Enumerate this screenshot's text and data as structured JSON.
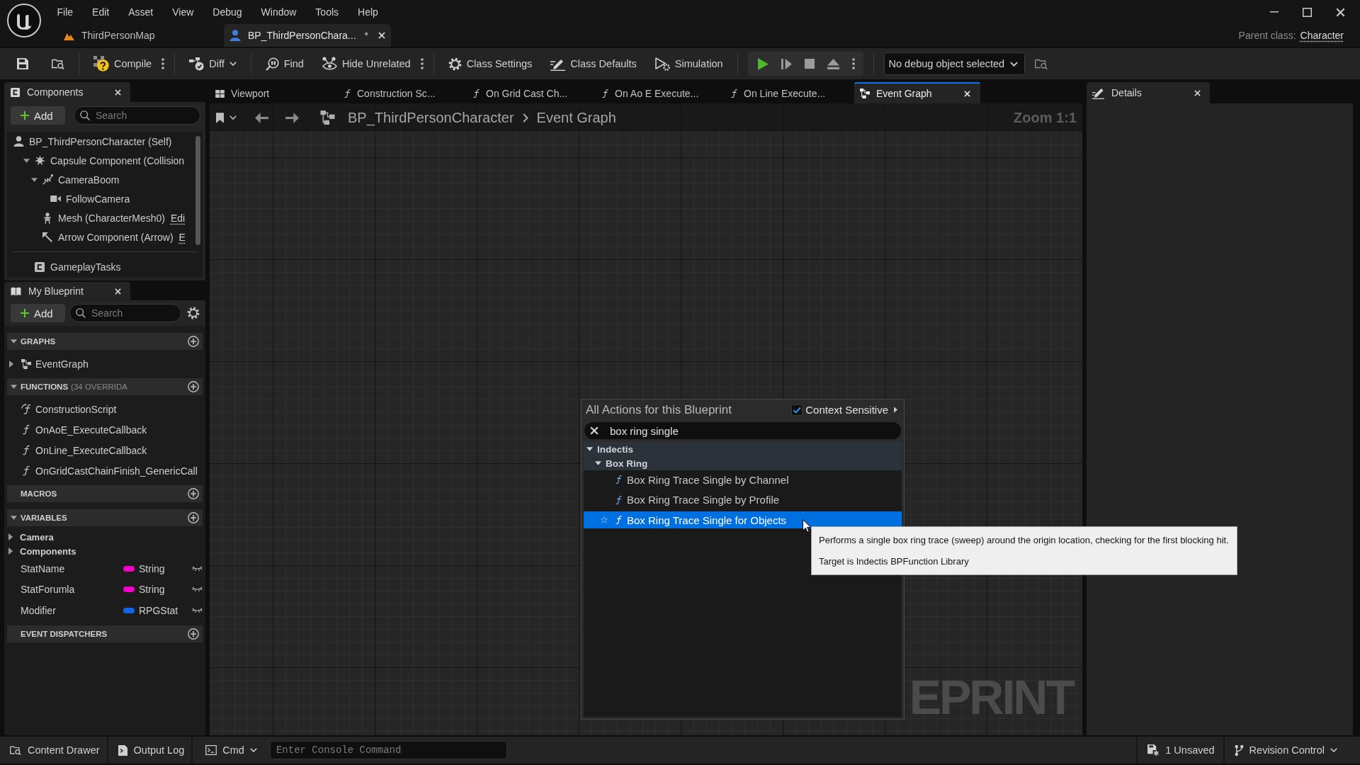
{
  "menu_bar": [
    "File",
    "Edit",
    "Asset",
    "View",
    "Debug",
    "Window",
    "Tools",
    "Help"
  ],
  "document_tabs": [
    {
      "label": "ThirdPersonMap",
      "kind": "level",
      "selected": false
    },
    {
      "label": "BP_ThirdPersonChara...",
      "kind": "blueprint",
      "selected": true,
      "unsaved_mark": "*"
    }
  ],
  "parent_class": {
    "label": "Parent class:",
    "value": "Character"
  },
  "toolbar": {
    "groups": [
      {
        "buttons": [
          {
            "kind": "save",
            "options": false,
            "dropdown": false
          },
          {
            "kind": "browse",
            "options": false,
            "dropdown": false
          }
        ]
      },
      {
        "buttons": [
          {
            "kind": "compile",
            "label": "Compile",
            "options": true,
            "dropdown": false
          }
        ]
      },
      {
        "buttons": [
          {
            "kind": "diff",
            "label": "Diff",
            "options": false,
            "dropdown": true
          }
        ]
      },
      {
        "buttons": [
          {
            "kind": "find",
            "label": "Find",
            "options": false,
            "dropdown": false
          },
          {
            "kind": "hide_unrelated",
            "label": "Hide Unrelated",
            "options": true,
            "dropdown": false
          }
        ]
      },
      {
        "buttons": [
          {
            "kind": "class_settings",
            "label": "Class Settings",
            "options": false,
            "dropdown": false
          },
          {
            "kind": "class_defaults",
            "label": "Class Defaults",
            "options": false,
            "dropdown": false
          },
          {
            "kind": "simulation",
            "label": "Simulation",
            "options": false,
            "dropdown": false
          }
        ]
      }
    ],
    "play_controls": [
      {
        "kind": "play"
      },
      {
        "kind": "advance"
      },
      {
        "kind": "stop"
      },
      {
        "kind": "eject"
      }
    ],
    "debug_object": {
      "value": "No debug object selected"
    }
  },
  "components_panel": {
    "title": "Components",
    "add_label": "Add",
    "search_placeholder": "Search",
    "tree": [
      {
        "label": "BP_ThirdPersonCharacter (Self)",
        "kind": "self",
        "children": [
          {
            "label": "Capsule Component (Collision",
            "kind": "capsule",
            "expanded": true,
            "children": [
              {
                "label": "CameraBoom",
                "kind": "spring_arm",
                "expanded": true,
                "children": [
                  {
                    "label": "FollowCamera",
                    "kind": "camera"
                  }
                ]
              },
              {
                "label": "Mesh (CharacterMesh0)",
                "kind": "mesh",
                "link": "Edi"
              },
              {
                "label": "Arrow Component (Arrow)",
                "kind": "arrow",
                "link": "E"
              }
            ]
          }
        ]
      }
    ],
    "other": [
      {
        "label": "GameplayTasks",
        "kind": "class"
      }
    ]
  },
  "my_blueprint": {
    "title": "My Blueprint",
    "add_label": "Add",
    "search_placeholder": "Search",
    "sections": [
      {
        "title": "GRAPHS",
        "expandable": true,
        "items": [
          {
            "label": "EventGraph",
            "kind": "graph",
            "expanded": false
          }
        ]
      },
      {
        "title": "FUNCTIONS",
        "note": "(34 OVERRIDA",
        "expandable": true,
        "items": [
          {
            "label": "ConstructionScript",
            "kind": "construction"
          },
          {
            "label": "OnAoE_ExecuteCallback",
            "kind": "function"
          },
          {
            "label": "OnLine_ExecuteCallback",
            "kind": "function"
          },
          {
            "label": "OnGridCastChainFinish_GenericCall",
            "kind": "function"
          }
        ]
      },
      {
        "title": "MACROS",
        "expandable": false
      },
      {
        "title": "VARIABLES",
        "expandable": true,
        "categories": [
          {
            "label": "Camera",
            "expanded": false
          },
          {
            "label": "Components",
            "expanded": false
          }
        ],
        "variables": [
          {
            "name": "StatName",
            "type": "String",
            "color": "#f200c8"
          },
          {
            "name": "StatForumla",
            "type": "String",
            "color": "#f200c8"
          },
          {
            "name": "Modifier",
            "type": "RPGStat",
            "color": "#1463e6"
          }
        ]
      },
      {
        "title": "EVENT DISPATCHERS",
        "expandable": false
      }
    ]
  },
  "graph_editor": {
    "tabs": [
      {
        "label": "Viewport",
        "kind": "viewport",
        "selected": false
      },
      {
        "label": "Construction Sc...",
        "kind": "function",
        "selected": false
      },
      {
        "label": "On Grid Cast Ch...",
        "kind": "function",
        "selected": false
      },
      {
        "label": "On Ao E Execute...",
        "kind": "function",
        "selected": false
      },
      {
        "label": "On Line Execute...",
        "kind": "function",
        "selected": false
      },
      {
        "label": "Event Graph",
        "kind": "graph",
        "selected": true
      }
    ],
    "breadcrumb": [
      "BP_ThirdPersonCharacter",
      "Event Graph"
    ],
    "zoom_label": "Zoom 1:1",
    "corner_label": "EPRINT"
  },
  "details_panel": {
    "title": "Details"
  },
  "action_menu": {
    "title": "All Actions for this Blueprint",
    "context_sensitive": {
      "label": "Context Sensitive",
      "checked": true
    },
    "search": {
      "value": "box ring single"
    },
    "results": [
      {
        "label": "Indectis",
        "kind": "category",
        "expanded": true,
        "children": [
          {
            "label": "Box Ring",
            "kind": "category",
            "expanded": true,
            "children": [
              {
                "label": "Box Ring Trace Single by Channel",
                "kind": "function",
                "selected": false
              },
              {
                "label": "Box Ring Trace Single by Profile",
                "kind": "function",
                "selected": false
              },
              {
                "label": "Box Ring Trace Single for Objects",
                "kind": "function",
                "selected": true
              }
            ]
          }
        ]
      }
    ]
  },
  "tooltip": {
    "lines": [
      "Performs a single box ring trace (sweep) around the origin location, checking for the first blocking hit.",
      "Target is Indectis BPFunction Library"
    ]
  },
  "status_bar": {
    "buttons": [
      {
        "kind": "content_drawer",
        "label": "Content Drawer"
      },
      {
        "kind": "output_log",
        "label": "Output Log"
      }
    ],
    "console": {
      "label": "Cmd",
      "placeholder": "Enter Console Command"
    },
    "right": [
      {
        "kind": "unsaved",
        "label": "1 Unsaved",
        "dropdown": false
      },
      {
        "kind": "revision",
        "label": "Revision Control",
        "dropdown": true
      }
    ]
  }
}
